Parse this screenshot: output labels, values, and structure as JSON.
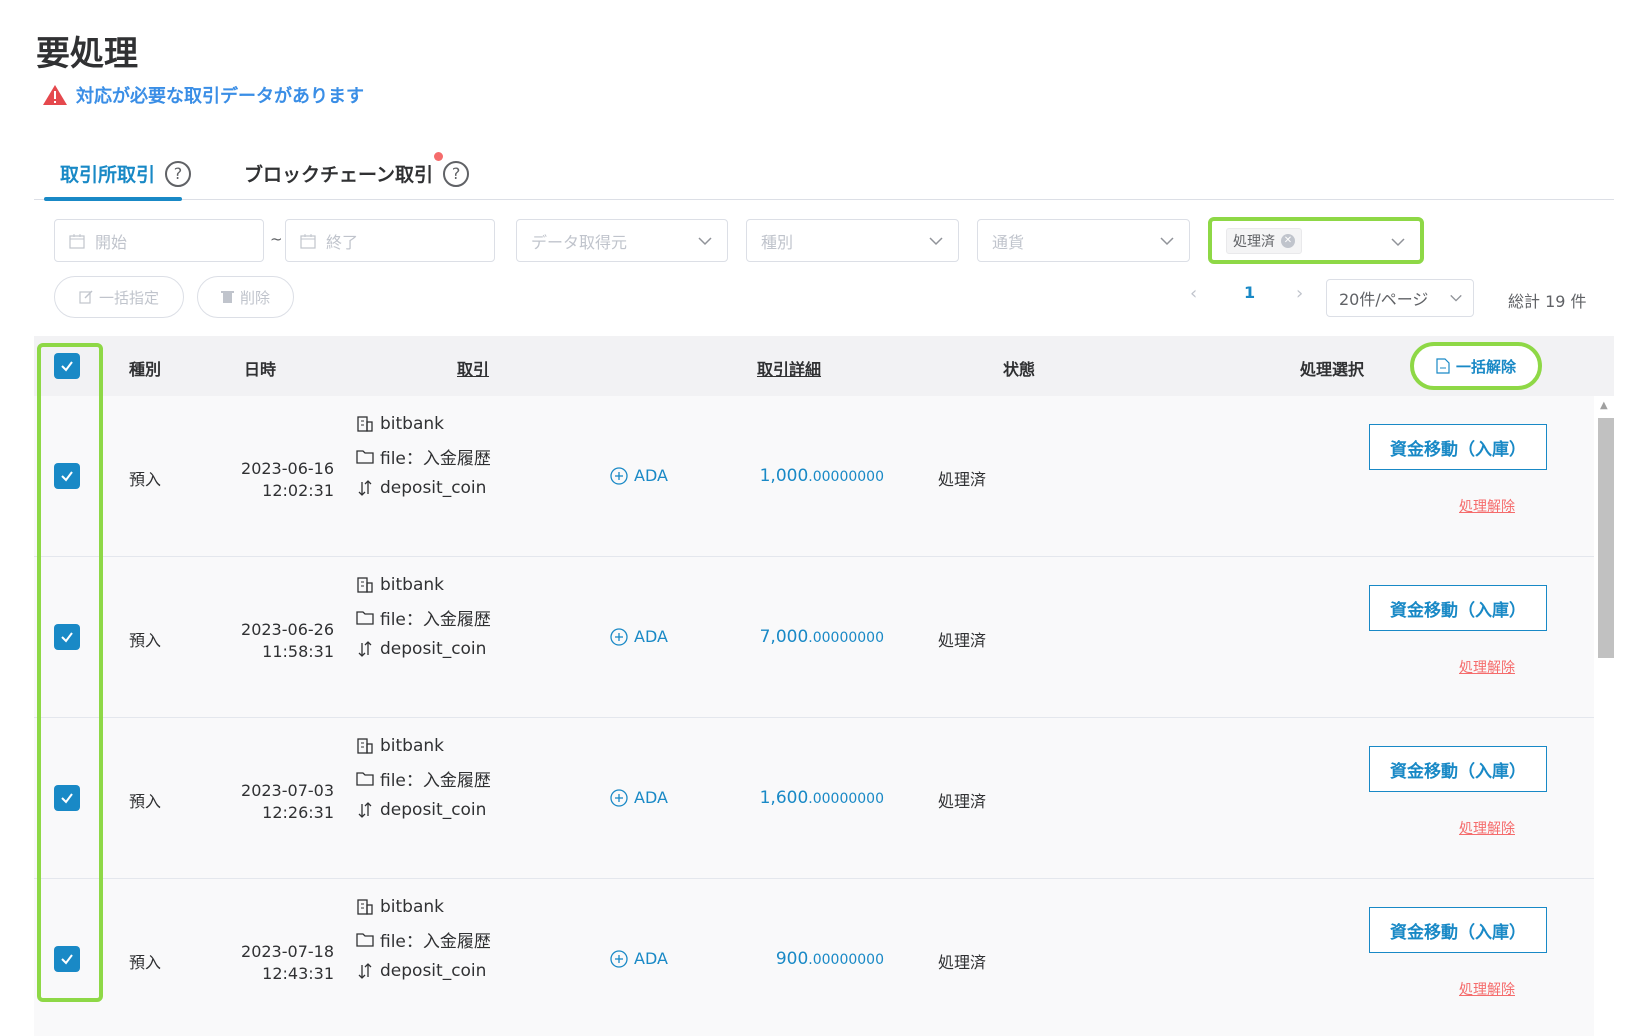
{
  "page": {
    "title": "要処理",
    "alert_text": "対応が必要な取引データがあります",
    "alert_color": "#e5484d"
  },
  "tabs": [
    {
      "label": "取引所取引",
      "active": true
    },
    {
      "label": "ブロックチェーン取引",
      "active": false,
      "has_dot": true
    }
  ],
  "filters": {
    "start_placeholder": "開始",
    "end_placeholder": "終了",
    "range_sep": "~",
    "source_placeholder": "データ取得元",
    "type_placeholder": "種別",
    "currency_placeholder": "通貨",
    "status_tag": "処理済"
  },
  "actions": {
    "bulk_assign": "一括指定",
    "delete": "削除"
  },
  "pagination": {
    "current_page": "1",
    "page_size": "20件/ページ",
    "total": "総計 19 件"
  },
  "table": {
    "headers": {
      "type": "種別",
      "datetime": "日時",
      "transaction": "取引",
      "detail": "取引詳細",
      "status": "状態",
      "process_select": "処理選択",
      "bulk_release": "一括解除"
    },
    "rows": [
      {
        "type": "預入",
        "date": "2023-06-16",
        "time": "12:02:31",
        "exchange": "bitbank",
        "file": "file：入金履歴",
        "tx_type": "deposit_coin",
        "currency": "ADA",
        "amount_int": "1,000",
        "amount_dec": ".00000000",
        "status": "処理済",
        "move_label": "資金移動（入庫）",
        "release_label": "処理解除",
        "checked": true
      },
      {
        "type": "預入",
        "date": "2023-06-26",
        "time": "11:58:31",
        "exchange": "bitbank",
        "file": "file：入金履歴",
        "tx_type": "deposit_coin",
        "currency": "ADA",
        "amount_int": "7,000",
        "amount_dec": ".00000000",
        "status": "処理済",
        "move_label": "資金移動（入庫）",
        "release_label": "処理解除",
        "checked": true
      },
      {
        "type": "預入",
        "date": "2023-07-03",
        "time": "12:26:31",
        "exchange": "bitbank",
        "file": "file：入金履歴",
        "tx_type": "deposit_coin",
        "currency": "ADA",
        "amount_int": "1,600",
        "amount_dec": ".00000000",
        "status": "処理済",
        "move_label": "資金移動（入庫）",
        "release_label": "処理解除",
        "checked": true
      },
      {
        "type": "預入",
        "date": "2023-07-18",
        "time": "12:43:31",
        "exchange": "bitbank",
        "file": "file：入金履歴",
        "tx_type": "deposit_coin",
        "currency": "ADA",
        "amount_int": "900",
        "amount_dec": ".00000000",
        "status": "処理済",
        "move_label": "資金移動（入庫）",
        "release_label": "処理解除",
        "checked": true
      }
    ]
  },
  "colors": {
    "accent": "#1989c6",
    "highlight": "#8ed846",
    "danger": "#f56c6c"
  }
}
